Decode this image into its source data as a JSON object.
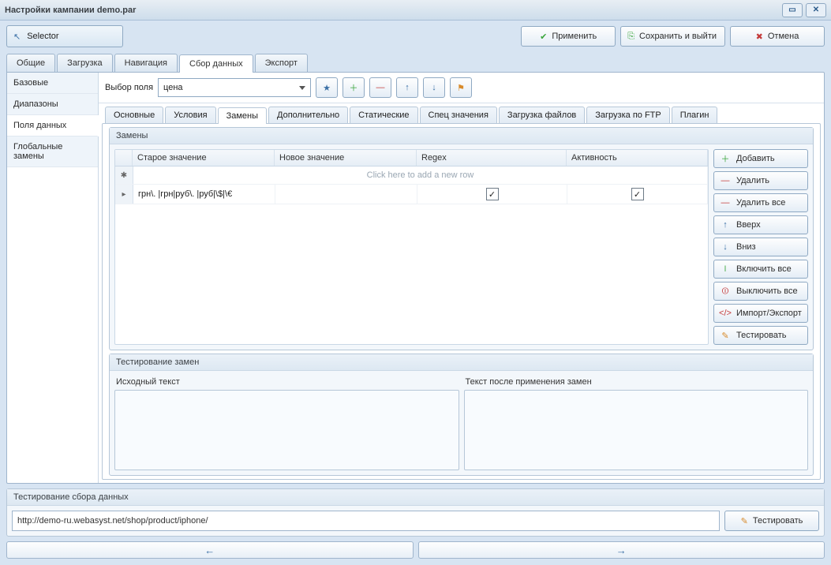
{
  "window": {
    "title": "Настройки кампании demo.par"
  },
  "toolbar": {
    "selector": "Selector",
    "apply": "Применить",
    "save_exit": "Сохранить и выйти",
    "cancel": "Отмена"
  },
  "main_tabs": {
    "items": [
      "Общие",
      "Загрузка",
      "Навигация",
      "Сбор данных",
      "Экспорт"
    ],
    "active_index": 3
  },
  "left_nav": {
    "items": [
      "Базовые",
      "Диапазоны",
      "Поля данных",
      "Глобальные замены"
    ],
    "active_index": 2
  },
  "field_select": {
    "label": "Выбор поля",
    "value": "цена"
  },
  "sub_tabs": {
    "items": [
      "Основные",
      "Условия",
      "Замены",
      "Дополнительно",
      "Статические",
      "Спец значения",
      "Загрузка файлов",
      "Загрузка по FTP",
      "Плагин"
    ],
    "active_index": 2
  },
  "replacements": {
    "group_title": "Замены",
    "columns": {
      "old": "Старое значение",
      "new": "Новое значение",
      "regex": "Regex",
      "active": "Активность"
    },
    "new_row_hint": "Click here to add a new row",
    "rows": [
      {
        "old": "грн\\. |грн|руб\\. |руб|\\$|\\€",
        "new": "",
        "regex": true,
        "active": true
      }
    ]
  },
  "side_actions": {
    "add": "Добавить",
    "delete": "Удалить",
    "delete_all": "Удалить все",
    "up": "Вверх",
    "down": "Вниз",
    "enable_all": "Включить все",
    "disable_all": "Выключить все",
    "import_export": "Импорт/Экспорт",
    "test": "Тестировать"
  },
  "testing_group": {
    "title": "Тестирование замен",
    "source_label": "Исходный текст",
    "result_label": "Текст после применения замен"
  },
  "bottom_group": {
    "title": "Тестирование сбора данных",
    "url": "http://demo-ru.webasyst.net/shop/product/iphone/",
    "test": "Тестировать"
  }
}
